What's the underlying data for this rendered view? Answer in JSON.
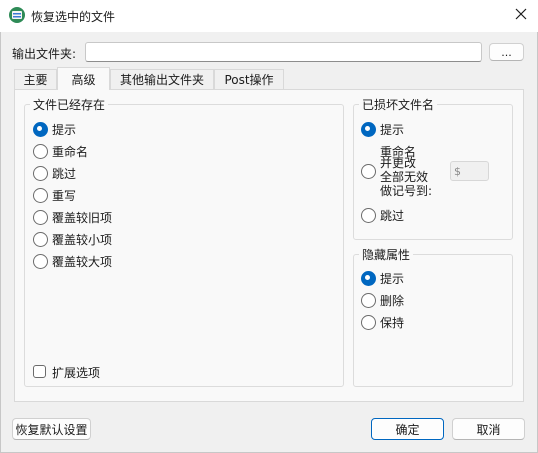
{
  "title": "恢复选中的文件",
  "output_folder": {
    "label": "输出文件夹:",
    "value": "",
    "browse_label": "..."
  },
  "tabs": [
    {
      "label": "主要",
      "active": false
    },
    {
      "label": "高级",
      "active": true
    },
    {
      "label": "其他输出文件夹",
      "active": false
    },
    {
      "label": "Post操作",
      "active": false
    }
  ],
  "file_exists": {
    "title": "文件已经存在",
    "options": [
      "提示",
      "重命名",
      "跳过",
      "重写",
      "覆盖较旧项",
      "覆盖较小项",
      "覆盖较大项"
    ],
    "selected": "提示",
    "expand_label": "扩展选项",
    "expand_checked": false
  },
  "damaged_name": {
    "title": "已损坏文件名",
    "options": [
      "提示",
      "重命名",
      "跳过"
    ],
    "rename_detail": [
      "并更改",
      "全部无效",
      "做记号到:"
    ],
    "selected": "提示",
    "mark_char": "$"
  },
  "hidden_attr": {
    "title": "隐藏属性",
    "options": [
      "提示",
      "删除",
      "保持"
    ],
    "selected": "提示"
  },
  "buttons": {
    "restore_defaults": "恢复默认设置",
    "ok": "确定",
    "cancel": "取消"
  },
  "colors": {
    "accent": "#0067c0",
    "dialog_bg": "#f0f0f0",
    "panel_bg": "#f9f9f9"
  }
}
